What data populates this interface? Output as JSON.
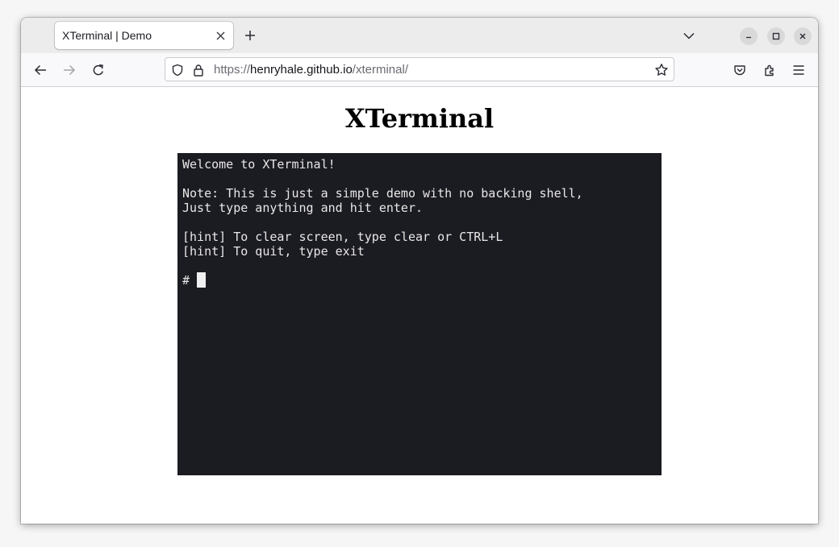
{
  "browser": {
    "tab": {
      "title": "XTerminal | Demo"
    },
    "address": {
      "scheme": "https://",
      "host": "henryhale.github.io",
      "path": "/xterminal/"
    },
    "icons": {
      "back": "arrow-left-icon",
      "forward": "arrow-right-icon",
      "reload": "reload-icon",
      "shield": "shield-icon",
      "lock": "lock-icon",
      "bookmark": "star-icon",
      "pocket": "pocket-icon",
      "extensions": "puzzle-icon",
      "menu": "hamburger-menu-icon",
      "tab_close": "close-icon",
      "new_tab": "plus-icon",
      "tab_list": "chevron-down-icon",
      "minimize": "minimize-icon",
      "maximize": "maximize-icon",
      "close_window": "close-icon"
    }
  },
  "page": {
    "title": "XTerminal"
  },
  "terminal": {
    "lines": [
      "Welcome to XTerminal!",
      "",
      "Note: This is just a simple demo with no backing shell,",
      "Just type anything and hit enter.",
      "",
      "[hint] To clear screen, type clear or CTRL+L",
      "[hint] To quit, type exit",
      ""
    ],
    "prompt": "# ",
    "input": ""
  },
  "colors": {
    "terminal_bg": "#1b1b22",
    "terminal_fg": "#e8e8e8",
    "tabbar_bg": "#ececec",
    "toolbar_bg": "#f9f9fb"
  }
}
